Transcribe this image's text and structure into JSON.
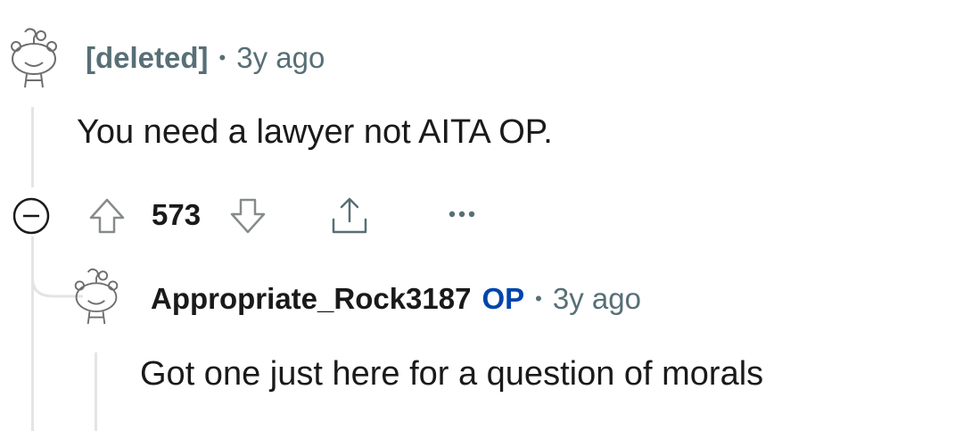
{
  "comments": [
    {
      "author": "[deleted]",
      "separator": "•",
      "time": "3y ago",
      "body": "You need a lawyer not AITA OP.",
      "score": "573",
      "avatar_icon": "snoo-avatar-icon"
    },
    {
      "author": "Appropriate_Rock3187",
      "op_badge": "OP",
      "separator": "•",
      "time": "3y ago",
      "body": "Got one just here for a question of morals",
      "avatar_icon": "snoo-avatar-icon"
    }
  ],
  "actions": {
    "collapse_icon": "collapse-minus-icon",
    "upvote_icon": "upvote-arrow-icon",
    "downvote_icon": "downvote-arrow-icon",
    "share_icon": "share-icon",
    "more_icon": "more-options-icon"
  },
  "colors": {
    "meta_gray": "#576f76",
    "op_blue": "#0045ac",
    "thread_line": "#e4e4e4",
    "text": "#1a1a1b"
  }
}
